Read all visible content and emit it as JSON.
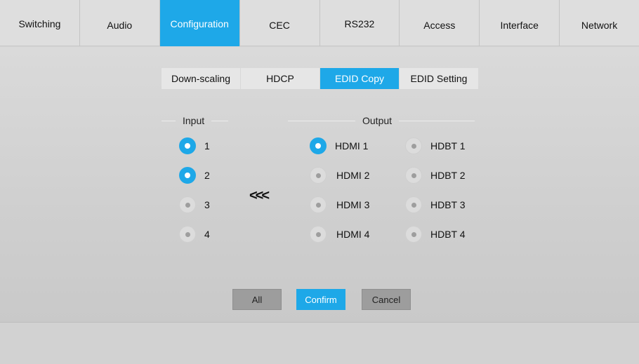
{
  "nav": {
    "tabs": [
      {
        "label": "Switching",
        "active": false
      },
      {
        "label": "Audio",
        "active": false
      },
      {
        "label": "Configuration",
        "active": true
      },
      {
        "label": "CEC",
        "active": false
      },
      {
        "label": "RS232",
        "active": false
      },
      {
        "label": "Access",
        "active": false
      },
      {
        "label": "Interface",
        "active": false
      },
      {
        "label": "Network",
        "active": false
      }
    ]
  },
  "subtabs": [
    {
      "label": "Down-scaling",
      "active": false
    },
    {
      "label": "HDCP",
      "active": false
    },
    {
      "label": "EDID Copy",
      "active": true
    },
    {
      "label": "EDID Setting",
      "active": false
    }
  ],
  "input": {
    "title": "Input",
    "options": [
      {
        "label": "1",
        "selected": true
      },
      {
        "label": "2",
        "selected": true
      },
      {
        "label": "3",
        "selected": false
      },
      {
        "label": "4",
        "selected": false
      }
    ]
  },
  "copy_arrow": "<<<",
  "output": {
    "title": "Output",
    "hdmi": [
      {
        "label": "HDMI 1",
        "selected": true
      },
      {
        "label": "HDMI 2",
        "selected": false
      },
      {
        "label": "HDMI 3",
        "selected": false
      },
      {
        "label": "HDMI 4",
        "selected": false
      }
    ],
    "hdbt": [
      {
        "label": "HDBT 1",
        "selected": false
      },
      {
        "label": "HDBT 2",
        "selected": false
      },
      {
        "label": "HDBT 3",
        "selected": false
      },
      {
        "label": "HDBT 4",
        "selected": false
      }
    ]
  },
  "buttons": {
    "all": "All",
    "confirm": "Confirm",
    "cancel": "Cancel"
  },
  "colors": {
    "accent": "#1ea8e8"
  }
}
